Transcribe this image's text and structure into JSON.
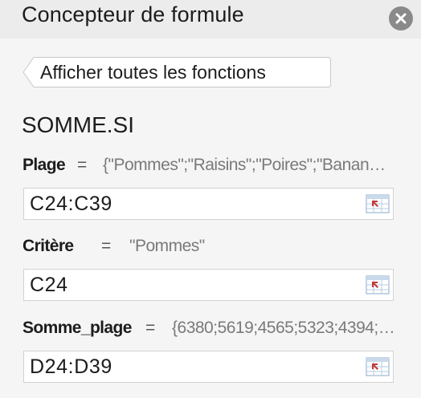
{
  "panel": {
    "title": "Concepteur de formule",
    "close_icon": "close-icon"
  },
  "back_button": {
    "label": "Afficher toutes les fonctions"
  },
  "function_name": "SOMME.SI",
  "arguments": [
    {
      "name": "Plage",
      "equals": "=",
      "preview": "{\"Pommes\";\"Raisins\";\"Poires\";\"Banan…",
      "value": "C24:C39",
      "icon": "range-select-icon"
    },
    {
      "name": "Critère",
      "equals": "=",
      "preview": "\"Pommes\"",
      "value": "C24",
      "icon": "range-select-icon"
    },
    {
      "name": "Somme_plage",
      "equals": "=",
      "preview": "{6380;5619;4565;5323;4394;…",
      "value": "D24:D39",
      "icon": "range-select-icon"
    }
  ],
  "colors": {
    "background": "#f5f5f5",
    "header": "#ececec",
    "close_button": "#8a8a8a",
    "preview_text": "#7a7a7a"
  }
}
